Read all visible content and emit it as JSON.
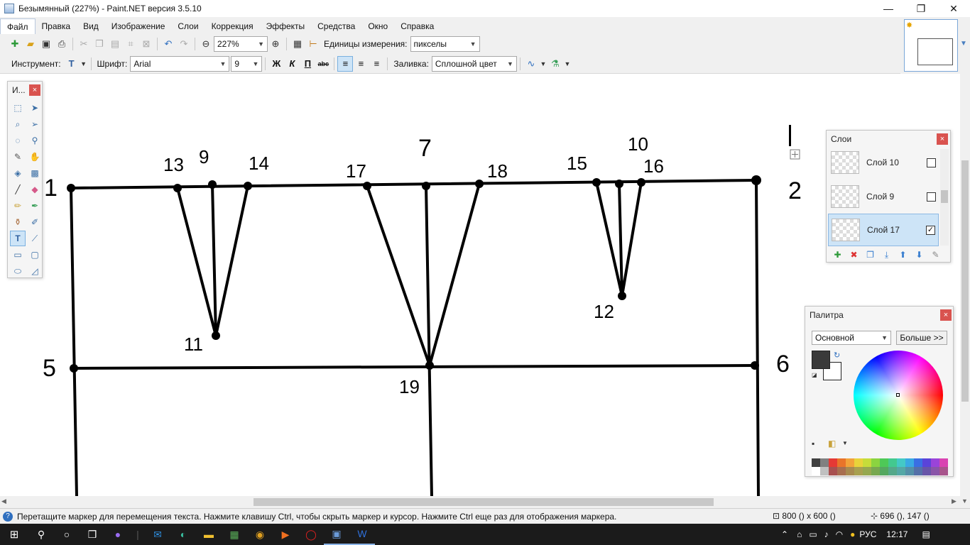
{
  "window": {
    "title": "Безымянный (227%) - Paint.NET версия 3.5.10",
    "minimize": "—",
    "restore": "❐",
    "close": "✕"
  },
  "menu": {
    "items": [
      "Файл",
      "Правка",
      "Вид",
      "Изображение",
      "Слои",
      "Коррекция",
      "Эффекты",
      "Средства",
      "Окно",
      "Справка"
    ]
  },
  "toolbar": {
    "zoom_value": "227%",
    "units_label": "Единицы измерения:",
    "units_value": "пикселы"
  },
  "textbar": {
    "tool_label": "Инструмент:",
    "font_label": "Шрифт:",
    "font_value": "Arial",
    "size_value": "9",
    "bold": "Ж",
    "italic": "К",
    "underline": "П",
    "strike": "abc",
    "fill_label": "Заливка:",
    "fill_value": "Сплошной цвет"
  },
  "tools_panel": {
    "title": "И...",
    "close": "×"
  },
  "layers_panel": {
    "title": "Слои",
    "close": "×",
    "layers": [
      {
        "name": "Слой 10",
        "visible": false,
        "selected": false
      },
      {
        "name": "Слой 9",
        "visible": false,
        "selected": false
      },
      {
        "name": "Слой 17",
        "visible": true,
        "selected": true
      }
    ]
  },
  "palette_panel": {
    "title": "Палитра",
    "close": "×",
    "palette_select": "Основной",
    "more_button": "Больше >>",
    "primary_color": "#3a3a3a",
    "secondary_color": "#ffffff",
    "swatches": [
      "#404040",
      "#808080",
      "#e53935",
      "#e9742a",
      "#f2a33a",
      "#e8d33a",
      "#c6dc3a",
      "#8bd440",
      "#4ec957",
      "#43c98f",
      "#44c9c6",
      "#3aa9e3",
      "#3a6fe3",
      "#5a44d9",
      "#9a44d9",
      "#d944b2",
      "#ffffff",
      "#c0c0c0",
      "#a85050",
      "#a86e50",
      "#a88a50",
      "#a8a050",
      "#96a850",
      "#78a850",
      "#55a860",
      "#55a88a",
      "#55a8a6",
      "#5590a8",
      "#5570a8",
      "#6855a8",
      "#8a55a8",
      "#a8558c"
    ]
  },
  "canvas": {
    "point_labels": [
      {
        "text": "1"
      },
      {
        "text": "2"
      },
      {
        "text": "5"
      },
      {
        "text": "6"
      },
      {
        "text": "7"
      },
      {
        "text": "9"
      },
      {
        "text": "10"
      },
      {
        "text": "11"
      },
      {
        "text": "12"
      },
      {
        "text": "13"
      },
      {
        "text": "14"
      },
      {
        "text": "15"
      },
      {
        "text": "16"
      },
      {
        "text": "17"
      },
      {
        "text": "18"
      },
      {
        "text": "19"
      }
    ]
  },
  "status": {
    "help_text": "Перетащите маркер для перемещения текста. Нажмите клавишу Ctrl, чтобы скрыть маркер и курсор. Нажмите Ctrl еще раз для отображения маркера.",
    "image_size": "800 () x 600 ()",
    "cursor_pos": "696 (), 147 ()"
  },
  "taskbar": {
    "language": "РУС",
    "time": "12:17"
  }
}
